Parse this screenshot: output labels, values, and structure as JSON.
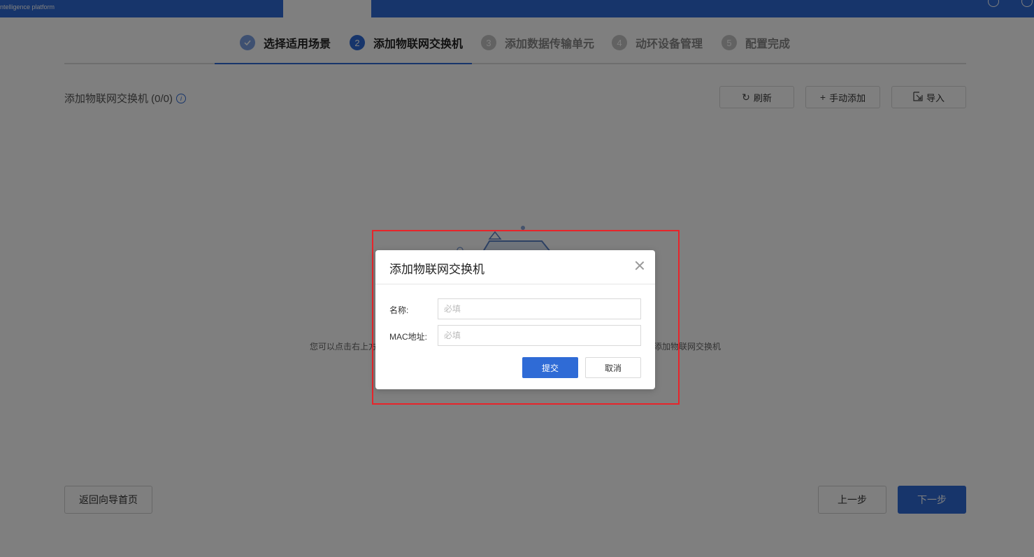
{
  "header": {
    "brand_subtitle": "ntelligence platform",
    "icons": [
      "star-icon",
      "help-icon"
    ]
  },
  "steps": [
    {
      "label": "选择适用场景",
      "status": "done"
    },
    {
      "label": "添加物联网交换机",
      "num": "2",
      "status": "current"
    },
    {
      "label": "添加数据传输单元",
      "num": "3",
      "status": "todo"
    },
    {
      "label": "动环设备管理",
      "num": "4",
      "status": "todo"
    },
    {
      "label": "配置完成",
      "num": "5",
      "status": "todo"
    }
  ],
  "section": {
    "title": "添加物联网交换机 (0/0)",
    "refresh_label": "刷新",
    "manual_add_label": "手动添加",
    "import_label": "导入"
  },
  "empty_state": {
    "hint_left": "您可以点击右上方",
    "hint_right": "添加物联网交换机"
  },
  "footer": {
    "back_home_label": "返回向导首页",
    "prev_label": "上一步",
    "next_label": "下一步"
  },
  "modal": {
    "title": "添加物联网交换机",
    "name_label": "名称:",
    "name_placeholder": "必填",
    "name_value": "",
    "mac_label": "MAC地址:",
    "mac_placeholder": "必填",
    "mac_value": "",
    "submit_label": "提交",
    "cancel_label": "取消"
  },
  "colors": {
    "primary": "#2f6bd6",
    "highlight_border": "#e8242a"
  }
}
